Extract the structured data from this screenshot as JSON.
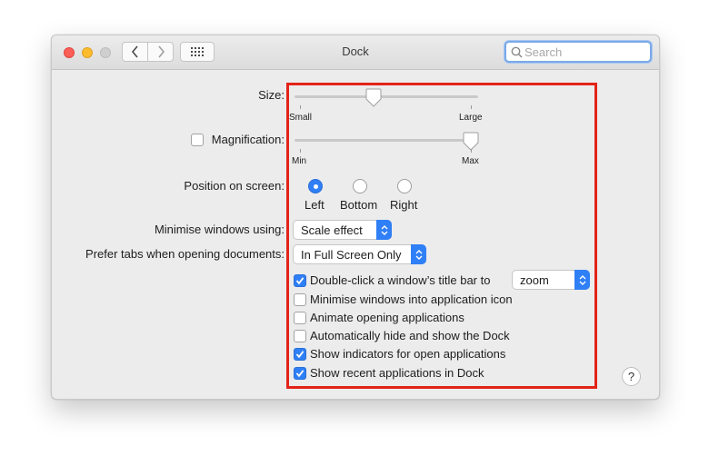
{
  "window": {
    "title": "Dock"
  },
  "toolbar": {
    "back": "back-chevron-icon",
    "forward": "forward-chevron-icon",
    "grid": "grid-icon"
  },
  "search": {
    "placeholder": "Search"
  },
  "size": {
    "label": "Size:",
    "min_label": "Small",
    "max_label": "Large",
    "value": 0.44
  },
  "magnification": {
    "label": "Magnification:",
    "checked": false,
    "min_label": "Min",
    "max_label": "Max",
    "value": 0.98
  },
  "position": {
    "label": "Position on screen:",
    "options": [
      {
        "label": "Left",
        "selected": true
      },
      {
        "label": "Bottom",
        "selected": false
      },
      {
        "label": "Right",
        "selected": false
      }
    ]
  },
  "minimise": {
    "label": "Minimise windows using:",
    "value": "Scale effect"
  },
  "prefer_tabs": {
    "label": "Prefer tabs when opening documents:",
    "value": "In Full Screen Only"
  },
  "checkboxes": [
    {
      "label": "Double-click a window’s title bar to",
      "checked": true
    },
    {
      "label": "Minimise windows into application icon",
      "checked": false
    },
    {
      "label": "Animate opening applications",
      "checked": false
    },
    {
      "label": "Automatically hide and show the Dock",
      "checked": false
    },
    {
      "label": "Show indicators for open applications",
      "checked": true
    },
    {
      "label": "Show recent applications in Dock",
      "checked": true
    }
  ],
  "double_click_action": {
    "value": "zoom"
  },
  "help": {
    "label": "?"
  },
  "colors": {
    "accent": "#2f7ff6",
    "highlight": "#e32318"
  }
}
